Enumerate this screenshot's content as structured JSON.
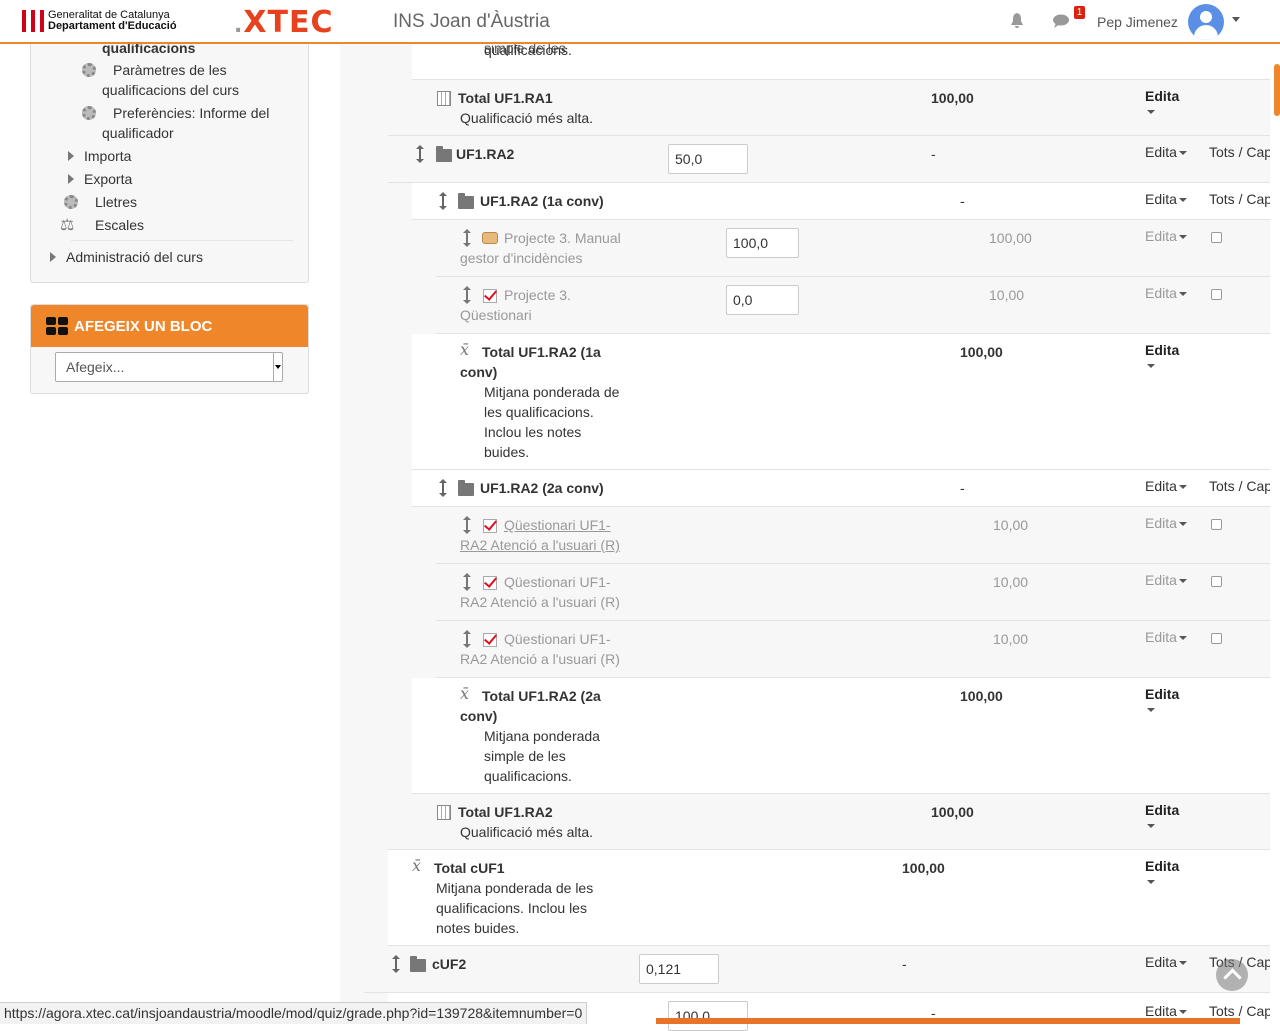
{
  "header": {
    "gencat_line1": "Generalitat de Catalunya",
    "gencat_line2": "Departament d'Educació",
    "xtec_logo": "XTEC",
    "site_title": "INS Joan d'Àustria",
    "messages_badge": "1",
    "user_name": "Pep Jimenez"
  },
  "sidebar": {
    "items": [
      {
        "label": "qualificacions"
      },
      {
        "label_l1": "Paràmetres de les",
        "label_l2": "qualificacions del curs"
      },
      {
        "label_l1": "Preferències: Informe del",
        "label_l2": "qualificador"
      },
      {
        "label": "Importa"
      },
      {
        "label": "Exporta"
      },
      {
        "label": "Lletres"
      },
      {
        "label": "Escales"
      },
      {
        "label": "Administració del curs"
      }
    ]
  },
  "add_block": {
    "title": "AFEGEIX UN BLOC",
    "select_value": "Afegeix..."
  },
  "grade_rows": {
    "partial_top": {
      "l1": "simple de les",
      "l2": "qualificacions."
    },
    "total_uf1ra1": {
      "name": "Total UF1.RA1",
      "desc": "Qualificació més alta.",
      "max": "100,00",
      "edit": "Edita"
    },
    "uf1ra2": {
      "name": "UF1.RA2",
      "weight": "50,0",
      "max": "-",
      "edit": "Edita",
      "select": "Tots / Cap"
    },
    "uf1ra2_1a": {
      "name": "UF1.RA2 (1a conv)",
      "max": "-",
      "edit": "Edita",
      "select": "Tots / Cap"
    },
    "proj3_manual": {
      "l1": "Projecte 3. Manual",
      "l2": "gestor d'incidències",
      "weight": "100,0",
      "max": "100,00",
      "edit": "Edita"
    },
    "proj3_quest": {
      "l1": "Projecte 3.",
      "l2": "Qüestionari",
      "weight": "0,0",
      "max": "10,00",
      "edit": "Edita"
    },
    "total_1a": {
      "l1": "Total UF1.RA2 (1a",
      "l2": "conv)",
      "d1": "Mitjana ponderada de",
      "d2": "les qualificacions.",
      "d3": "Inclou les notes",
      "d4": "buides.",
      "max": "100,00",
      "edit": "Edita"
    },
    "uf1ra2_2a": {
      "name": "UF1.RA2 (2a conv)",
      "max": "-",
      "edit": "Edita",
      "select": "Tots / Cap"
    },
    "quest_a": {
      "l1": "Qüestionari UF1-",
      "l2": "RA2 Atenció a l'usuari (R)",
      "max": "10,00",
      "edit": "Edita"
    },
    "quest_b": {
      "l1": "Qüestionari UF1-",
      "l2": "RA2 Atenció a l'usuari (R)",
      "max": "10,00",
      "edit": "Edita"
    },
    "quest_c": {
      "l1": "Qüestionari UF1-",
      "l2": "RA2 Atenció a l'usuari (R)",
      "max": "10,00",
      "edit": "Edita"
    },
    "total_2a": {
      "l1": "Total UF1.RA2 (2a",
      "l2": "conv)",
      "d1": "Mitjana ponderada",
      "d2": "simple de les",
      "d3": "qualificacions.",
      "max": "100,00",
      "edit": "Edita"
    },
    "total_uf1ra2": {
      "name": "Total UF1.RA2",
      "desc": "Qualificació més alta.",
      "max": "100,00",
      "edit": "Edita"
    },
    "total_cuf1": {
      "name": "Total cUF1",
      "d1": "Mitjana ponderada de les",
      "d2": "qualificacions. Inclou les",
      "d3": "notes buides.",
      "max": "100,00",
      "edit": "Edita"
    },
    "cuf2": {
      "name": "cUF2",
      "weight": "0,121",
      "max": "-",
      "edit": "Edita",
      "select": "Tots / Cap"
    },
    "partial_bottom": {
      "weight": "100,0",
      "max": "-",
      "edit": "Edita",
      "select": "Tots / Cap"
    }
  },
  "status_url": "https://agora.xtec.cat/insjoandaustria/moodle/mod/quiz/grade.php?id=139728&itemnumber=0"
}
